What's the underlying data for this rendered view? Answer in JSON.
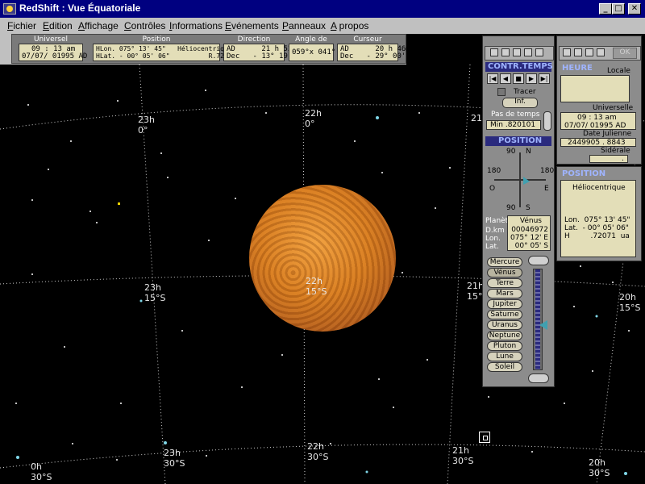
{
  "window": {
    "title": "RedShift : Vue Équatoriale",
    "min": "_",
    "max": "□",
    "close": "✕"
  },
  "menu": [
    "Fichier",
    "Edition",
    "Affichage",
    "Contrôles",
    "Informations",
    "Evénements",
    "Panneaux",
    "A propos"
  ],
  "toolbar": {
    "universel": {
      "title": "Universel",
      "line1": "09 : 13 am",
      "line2": "07/07/ 01995 AD"
    },
    "position": {
      "title": "Position",
      "line1": "HLon. 075° 13' 45\"   Héliocentrique",
      "line2": "HLat. - 00° 05' 06\"          R.72071 ua"
    },
    "direction": {
      "title": "Direction",
      "line1": "AD      21 h 53m",
      "line2": "Dec   - 13° 19'"
    },
    "angle": {
      "title": "Angle de vue",
      "line1": "059°x 041°"
    },
    "curseur": {
      "title": "Curseur",
      "line1": "AD      20 h 46m",
      "line2": "Dec   - 29° 00'"
    }
  },
  "grid_labels": [
    {
      "text": "23h\n0°"
    },
    {
      "text": "22h\n0°"
    },
    {
      "text": "21"
    },
    {
      "text": "23h\n15°S"
    },
    {
      "text": "22h\n15°S"
    },
    {
      "text": "21h\n15°"
    },
    {
      "text": "20h\n15°S"
    },
    {
      "text": "23h\n30°S"
    },
    {
      "text": "22h\n30°S"
    },
    {
      "text": "21h\n30°S"
    },
    {
      "text": "20h\n30°S"
    },
    {
      "text": "0h\n30°S"
    }
  ],
  "time_panel": {
    "title": "CONTR.TEMPS",
    "tracer": "Tracer",
    "infini": "Inf.",
    "pas_label": "Pas de temps",
    "pas_value": "Min  .820101",
    "ctrl_buttons": [
      "|◀",
      "◀",
      "■",
      "▶",
      "▶|"
    ]
  },
  "position_panel": {
    "title": "POSITION",
    "north": "N",
    "south": "S",
    "east": "E",
    "west": "O",
    "deg90a": "90",
    "deg90b": "90",
    "deg180a": "180",
    "deg180b": "180",
    "planet_label": "Planète",
    "planet": "Vénus",
    "dkm_label": "D.km",
    "dkm": "00046972",
    "lon_label": "Lon.",
    "lon": "075° 12' E",
    "lat_label": "Lat.",
    "lat": "00° 05' S"
  },
  "planets": [
    "Mercure",
    "Vénus",
    "Terre",
    "Mars",
    "Jupiter",
    "Saturne",
    "Uranus",
    "Neptune",
    "Pluton",
    "Lune",
    "Soleil"
  ],
  "time_info": {
    "heure": "HEURE",
    "locale": "Locale",
    "universelle_label": "Universelle",
    "universelle_time": "09 : 13 am",
    "universelle_date": "07/07/ 01995 AD",
    "julienne_label": "Date Julienne",
    "julienne_value": "2449905 . 8843",
    "siderale_label": "Sidérale",
    "siderale_value": ".",
    "ok": "OK"
  },
  "helio_panel": {
    "title": "POSITION",
    "mode": "Héliocentrique",
    "lon": "Lon.  075° 13' 45\"",
    "lat": "Lat.  - 00° 05' 06\"",
    "h": "H         .72071  ua"
  }
}
